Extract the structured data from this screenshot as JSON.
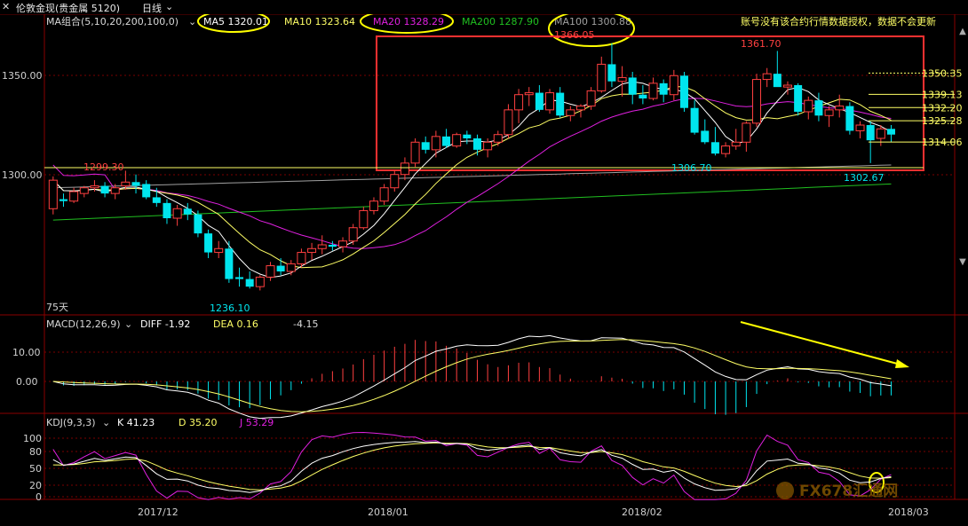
{
  "header": {
    "instrument": "伦敦金现(贵金属 5120)",
    "period": "日线",
    "close_icon": "close-icon",
    "back_icon": "arrow-left-icon"
  },
  "ma_bar": {
    "combo": "MA组合(5,10,20,200,100,0)",
    "ma5": "MA5 1320.01",
    "ma10": "MA10 1323.64",
    "ma20": "MA20 1328.29",
    "ma200": "MA200 1287.90",
    "ma100": "MA100 1300.88",
    "notice": "账号没有该合约行情数据授权，数据不会更新"
  },
  "price_axis": [
    "1350.00",
    "1300.00"
  ],
  "price_annotations": {
    "high1": "1299.30",
    "low1": "1236.10",
    "high2": "1366.05",
    "high3": "1361.70",
    "low2": "1306.70",
    "low3": "1302.67",
    "days": "75天"
  },
  "fib_levels": [
    {
      "label": "1350.35",
      "value": 1350.35
    },
    {
      "label": "1339.13",
      "value": 1339.13
    },
    {
      "label": "1332.20",
      "value": 1332.2
    },
    {
      "label": "1325.28",
      "value": 1325.28
    },
    {
      "label": "1314.06",
      "value": 1314.06
    }
  ],
  "macd_bar": {
    "title": "MACD(12,26,9)",
    "diff": "DIFF  -1.92",
    "dea": "DEA  0.16",
    "macd": "-4.15"
  },
  "macd_axis": [
    "10.00",
    "0.00"
  ],
  "kdj_bar": {
    "title": "KDJ(9,3,3)",
    "k": "K  41.23",
    "d": "D  35.20",
    "j": "J  53.29"
  },
  "kdj_axis": [
    "100",
    "80",
    "50",
    "20",
    "0"
  ],
  "date_axis": [
    "2017/12",
    "2018/01",
    "2018/02",
    "2018/03"
  ],
  "watermark": "FX678汇通网",
  "colors": {
    "up": "#ff4040",
    "down": "#00e5ee",
    "ma5": "#ffffff",
    "ma10": "#ffff66",
    "ma20": "#e020e0",
    "ma200": "#20c020",
    "ma100": "#a0a0a0",
    "grid": "#7a0000",
    "highlight": "#ff3030",
    "circle": "#ffff00"
  },
  "chart_data": {
    "type": "candlestick",
    "candles": [
      [
        1279,
        1296,
        1276,
        1294
      ],
      [
        1284,
        1287,
        1280,
        1283
      ],
      [
        1283,
        1290,
        1282,
        1288
      ],
      [
        1287,
        1291,
        1285,
        1290
      ],
      [
        1290,
        1294,
        1288,
        1291
      ],
      [
        1291,
        1293,
        1285,
        1287
      ],
      [
        1287,
        1292,
        1284,
        1290
      ],
      [
        1291,
        1299,
        1289,
        1293
      ],
      [
        1293,
        1297,
        1287,
        1291
      ],
      [
        1292,
        1294,
        1284,
        1285
      ],
      [
        1285,
        1290,
        1280,
        1282
      ],
      [
        1282,
        1284,
        1271,
        1274
      ],
      [
        1274,
        1281,
        1270,
        1279
      ],
      [
        1279,
        1282,
        1273,
        1276
      ],
      [
        1276,
        1278,
        1264,
        1266
      ],
      [
        1266,
        1268,
        1253,
        1256
      ],
      [
        1256,
        1262,
        1253,
        1258
      ],
      [
        1258,
        1262,
        1240,
        1242
      ],
      [
        1243,
        1248,
        1238,
        1242
      ],
      [
        1242,
        1246,
        1237,
        1238
      ],
      [
        1238,
        1244,
        1236,
        1243
      ],
      [
        1243,
        1251,
        1241,
        1249
      ],
      [
        1249,
        1253,
        1244,
        1246
      ],
      [
        1246,
        1252,
        1244,
        1250
      ],
      [
        1250,
        1258,
        1248,
        1256
      ],
      [
        1256,
        1261,
        1252,
        1258
      ],
      [
        1258,
        1265,
        1255,
        1260
      ],
      [
        1260,
        1262,
        1257,
        1259
      ],
      [
        1259,
        1264,
        1256,
        1262
      ],
      [
        1262,
        1271,
        1260,
        1269
      ],
      [
        1269,
        1280,
        1268,
        1278
      ],
      [
        1278,
        1285,
        1276,
        1283
      ],
      [
        1283,
        1292,
        1281,
        1290
      ],
      [
        1290,
        1299,
        1288,
        1297
      ],
      [
        1297,
        1306,
        1294,
        1303
      ],
      [
        1303,
        1316,
        1301,
        1314
      ],
      [
        1314,
        1317,
        1308,
        1310
      ],
      [
        1310,
        1320,
        1306,
        1317
      ],
      [
        1317,
        1321,
        1311,
        1312
      ],
      [
        1312,
        1319,
        1311,
        1318
      ],
      [
        1318,
        1320,
        1313,
        1316
      ],
      [
        1316,
        1318,
        1307,
        1310
      ],
      [
        1310,
        1316,
        1306,
        1314
      ],
      [
        1314,
        1320,
        1312,
        1318
      ],
      [
        1318,
        1334,
        1316,
        1331
      ],
      [
        1331,
        1342,
        1324,
        1339
      ],
      [
        1339,
        1343,
        1333,
        1340
      ],
      [
        1340,
        1344,
        1330,
        1331
      ],
      [
        1331,
        1342,
        1329,
        1340
      ],
      [
        1340,
        1343,
        1327,
        1328
      ],
      [
        1328,
        1333,
        1325,
        1331
      ],
      [
        1331,
        1334,
        1327,
        1333
      ],
      [
        1333,
        1343,
        1331,
        1341
      ],
      [
        1341,
        1359,
        1340,
        1355
      ],
      [
        1355,
        1366,
        1343,
        1346
      ],
      [
        1346,
        1354,
        1338,
        1348
      ],
      [
        1348,
        1351,
        1334,
        1339
      ],
      [
        1339,
        1344,
        1334,
        1337
      ],
      [
        1337,
        1348,
        1336,
        1345
      ],
      [
        1345,
        1347,
        1335,
        1339
      ],
      [
        1339,
        1352,
        1336,
        1349
      ],
      [
        1349,
        1351,
        1330,
        1332
      ],
      [
        1332,
        1336,
        1318,
        1319
      ],
      [
        1320,
        1326,
        1313,
        1314
      ],
      [
        1314,
        1322,
        1307,
        1308
      ],
      [
        1308,
        1314,
        1306,
        1312
      ],
      [
        1312,
        1321,
        1310,
        1314
      ],
      [
        1314,
        1325,
        1309,
        1324
      ],
      [
        1324,
        1350,
        1322,
        1347
      ],
      [
        1347,
        1353,
        1343,
        1350
      ],
      [
        1350,
        1362,
        1346,
        1343
      ],
      [
        1343,
        1346,
        1339,
        1344
      ],
      [
        1344,
        1345,
        1328,
        1330
      ],
      [
        1330,
        1338,
        1326,
        1336
      ],
      [
        1336,
        1340,
        1325,
        1328
      ],
      [
        1328,
        1333,
        1322,
        1331
      ],
      [
        1331,
        1339,
        1327,
        1333
      ],
      [
        1333,
        1335,
        1318,
        1320
      ],
      [
        1320,
        1325,
        1316,
        1323
      ],
      [
        1323,
        1325,
        1303,
        1315
      ],
      [
        1316,
        1323,
        1312,
        1321
      ],
      [
        1321,
        1323,
        1314,
        1318
      ]
    ],
    "ma200_range": [
      1273,
      1292
    ],
    "yrange": [
      1225,
      1372
    ]
  }
}
